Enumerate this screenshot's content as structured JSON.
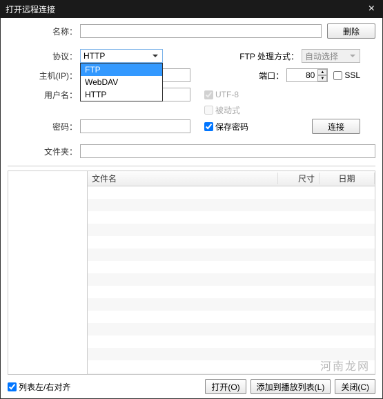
{
  "title": "打开远程连接",
  "labels": {
    "name": "名称：",
    "protocol": "协议：",
    "host": "主机(IP)：",
    "username": "用户名：",
    "password": "密码：",
    "folder": "文件夹：",
    "ftp_mode": "FTP 处理方式：",
    "port": "端口："
  },
  "fields": {
    "name": "",
    "protocol_selected": "HTTP",
    "protocol_options": [
      "FTP",
      "WebDAV",
      "HTTP"
    ],
    "host": "",
    "username": "",
    "password": "",
    "folder": "",
    "ftp_mode_value": "自动选择",
    "port": "80"
  },
  "checkboxes": {
    "ssl": "SSL",
    "utf8": "UTF-8",
    "passive": "被动式",
    "save_password": "保存密码"
  },
  "buttons": {
    "delete": "删除",
    "connect": "连接",
    "open": "打开(O)",
    "add_playlist": "添加到播放列表(L)",
    "close": "关闭(C)"
  },
  "table": {
    "columns": {
      "filename": "文件名",
      "size": "尺寸",
      "date": "日期"
    }
  },
  "bottom": {
    "align_checkbox": "列表左/右对齐"
  },
  "watermark": "河南龙网"
}
